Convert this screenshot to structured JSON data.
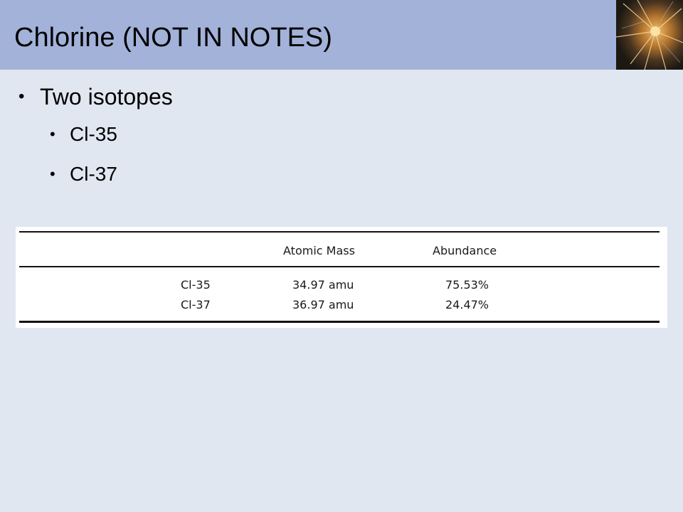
{
  "slide": {
    "title": "Chlorine (NOT IN NOTES)"
  },
  "bullets": {
    "level1": "Two isotopes",
    "level2": [
      "Cl-35",
      "Cl-37"
    ],
    "bullet_glyph": "•"
  },
  "isotope_table": {
    "headers": [
      "",
      "Atomic Mass",
      "Abundance"
    ],
    "rows": [
      [
        "Cl-35",
        "34.97 amu",
        "75.53%"
      ],
      [
        "Cl-37",
        "36.97 amu",
        "24.47%"
      ]
    ]
  },
  "colors": {
    "title_bar": "#a3b2d9",
    "background": "#e1e7f1",
    "table_background": "#ffffff"
  },
  "decorations": {
    "corner_image": "crystal-photo"
  }
}
